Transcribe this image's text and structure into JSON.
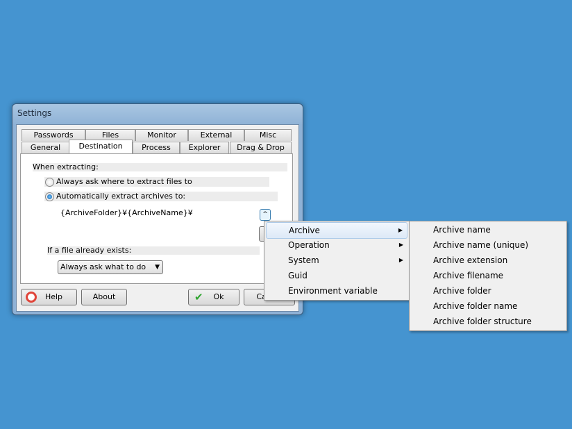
{
  "window": {
    "title": "Settings"
  },
  "tabs_row1": [
    "Passwords",
    "Files",
    "Monitor",
    "External",
    "Misc"
  ],
  "tabs_row2": [
    "General",
    "Destination",
    "Process",
    "Explorer",
    "Drag & Drop"
  ],
  "selected_tab": "Destination",
  "panel": {
    "when_extracting": "When extracting:",
    "option_ask": "Always ask where to extract files to",
    "option_auto": "Automatically extract archives to:",
    "selected_option": "auto",
    "path": "{ArchiveFolder}¥{ArchiveName}¥",
    "expand_glyph": "^",
    "if_exists": "If a file already exists:",
    "if_exists_value": "Always ask what to do"
  },
  "buttons": {
    "help": "Help",
    "about": "About",
    "ok": "Ok",
    "cancel": "Cancel"
  },
  "menu": [
    {
      "label": "Archive",
      "submenu": true,
      "highlighted": true
    },
    {
      "label": "Operation",
      "submenu": true
    },
    {
      "label": "System",
      "submenu": true
    },
    {
      "label": "Guid"
    },
    {
      "label": "Environment variable"
    }
  ],
  "submenu": [
    "Archive name",
    "Archive name (unique)",
    "Archive extension",
    "Archive filename",
    "Archive folder",
    "Archive folder name",
    "Archive folder structure"
  ]
}
